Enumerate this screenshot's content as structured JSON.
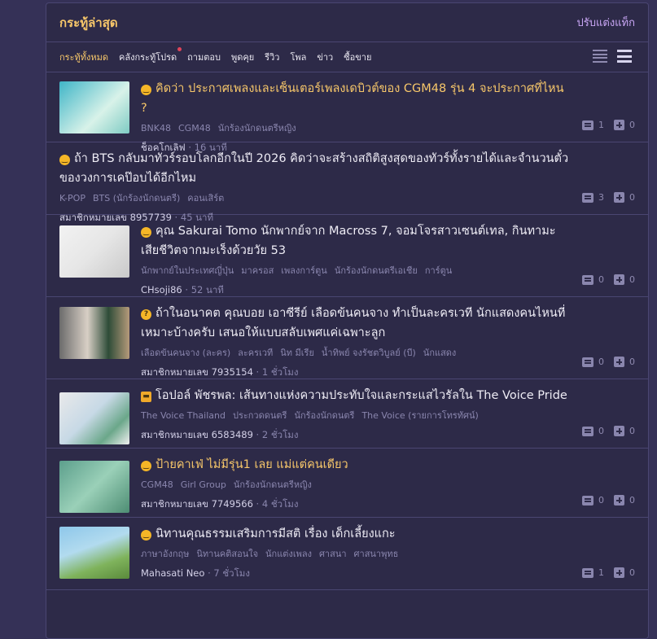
{
  "header": {
    "title": "กระทู้ล่าสุด",
    "customize": "ปรับแต่งแท็ก"
  },
  "tabs": [
    {
      "label": "กระทู้ทั้งหมด",
      "active": true
    },
    {
      "label": "คลังกระทู้โปรด",
      "dot": true
    },
    {
      "label": "ถามตอบ"
    },
    {
      "label": "พูดคุย"
    },
    {
      "label": "รีวิว"
    },
    {
      "label": "โพล"
    },
    {
      "label": "ข่าว"
    },
    {
      "label": "ซื้อขาย"
    }
  ],
  "topics": [
    {
      "emoji": "face",
      "title": "คิดว่า ประกาศเพลงและเซ็นเตอร์เพลงเดบิวต์ของ CGM48 รุ่น 4 จะประกาศที่ไหน ?",
      "highlight": true,
      "tags": [
        "BNK48",
        "CGM48",
        "นักร้องนักดนตรีหญิง"
      ],
      "author": "ช็อคโกเลิฟ",
      "time": "16 นาที",
      "comments": "1",
      "votes": "0"
    },
    {
      "emoji": "face",
      "title": "ถ้า BTS กลับมาทัวร์รอบโลกอีกในปี 2026 คิดว่าจะสร้างสถิติสูงสุดของทัวร์ทั้งรายได้และจำนวนตั๋วของวงการเคป๊อบได้อีกไหม",
      "tags": [
        "K-POP",
        "BTS (นักร้องนักดนตรี)",
        "คอนเสิร์ต"
      ],
      "author": "สมาชิกหมายเลข 8957739",
      "time": "45 นาที",
      "comments": "3",
      "votes": "0"
    },
    {
      "emoji": "face",
      "title": "คุณ Sakurai Tomo นักพากย์จาก Macross 7, จอมโจรสาวเซนต์เทล, กินทามะ เสียชีวิตจากมะเร็งด้วยวัย 53",
      "tags": [
        "นักพากย์ในประเทศญี่ปุ่น",
        "มาครอส",
        "เพลงการ์ตูน",
        "นักร้องนักดนตรีเอเชีย",
        "การ์ตูน"
      ],
      "author": "CHsoji86",
      "time": "52 นาที",
      "comments": "0",
      "votes": "0"
    },
    {
      "emoji": "question",
      "title": "ถ้าในอนาคต คุณบอย เอาซีรีย์ เลือดข้นคนจาง ทำเป็นละครเวที นักแสดงคนไหนที่เหมาะบ้างครับ เสนอให้แบบสลับเพศแค่เฉพาะลูก",
      "tags": [
        "เลือดข้นคนจาง (ละคร)",
        "ละครเวที",
        "นิท มีเรีย",
        "น้ำทิพย์ จงรัชตวิบูลย์ (บี)",
        "นักแสดง"
      ],
      "author": "สมาชิกหมายเลข 7935154",
      "time": "1 ชั่วโมง",
      "comments": "0",
      "votes": "0"
    },
    {
      "emoji": "tv",
      "title": "โอปอล์ พัชรพล: เส้นทางแห่งความประทับใจและกระแสไวรัลใน The Voice Pride",
      "tags": [
        "The Voice Thailand",
        "ประกวดดนตรี",
        "นักร้องนักดนตรี",
        "The Voice (รายการโทรทัศน์)"
      ],
      "author": "สมาชิกหมายเลข 6583489",
      "time": "2 ชั่วโมง",
      "comments": "0",
      "votes": "0"
    },
    {
      "emoji": "face",
      "title": "ป้ายคาเฟ่ ไม่มีรุ่น1 เลย แม่แต่คนเดียว",
      "highlight": true,
      "tags": [
        "CGM48",
        "Girl Group",
        "นักร้องนักดนตรีหญิง"
      ],
      "author": "สมาชิกหมายเลข 7749566",
      "time": "4 ชั่วโมง",
      "comments": "0",
      "votes": "0"
    },
    {
      "emoji": "face",
      "title": "นิทานคุณธรรมเสริมการมีสติ เรื่อง เด็กเลี้ยงแกะ",
      "tags": [
        "ภาษาอังกฤษ",
        "นิทานคติสอนใจ",
        "นักแต่งเพลง",
        "ศาสนา",
        "ศาสนาพุทธ"
      ],
      "author": "Mahasati Neo",
      "time": "7 ชั่วโมง",
      "comments": "1",
      "votes": "0"
    }
  ]
}
